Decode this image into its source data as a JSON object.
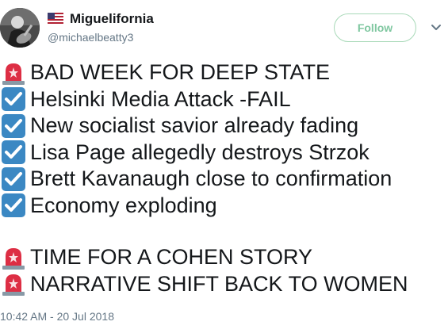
{
  "user": {
    "display_name": "Miguelifornia",
    "handle": "@michaelbeatty3",
    "flag_icon": "us-flag-icon",
    "follow_label": "Follow"
  },
  "tweet": {
    "lines": [
      {
        "icon": "siren-icon",
        "text": "BAD WEEK FOR DEEP STATE"
      },
      {
        "icon": "check-box-icon",
        "text": "Helsinki Media Attack -FAIL"
      },
      {
        "icon": "check-box-icon",
        "text": "New socialist savior already fading"
      },
      {
        "icon": "check-box-icon",
        "text": "Lisa Page allegedly destroys Strzok"
      },
      {
        "icon": "check-box-icon",
        "text": "Brett Kavanaugh close to confirmation"
      },
      {
        "icon": "check-box-icon",
        "text": "Economy exploding"
      },
      {
        "icon": "siren-icon",
        "text": "TIME FOR A COHEN STORY"
      },
      {
        "icon": "siren-icon",
        "text": "NARRATIVE SHIFT BACK TO WOMEN"
      }
    ],
    "timestamp": "10:42 AM - 20 Jul 2018"
  },
  "colors": {
    "follow_border": "#a8d9b8",
    "follow_text": "#7fc7a0",
    "secondary_text": "#657786",
    "check_blue": "#3b88c3",
    "siren_red": "#dd2e44"
  }
}
